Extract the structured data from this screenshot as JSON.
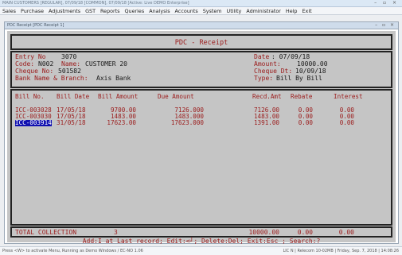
{
  "window": {
    "title": "MAIN   CUSTOMERS [REGULAR], 07/09/18   [COMMON], 07/09/18   [Active: Live DEMO   Enterprise]",
    "controls": "– ▫ ×"
  },
  "menu": [
    "Sales",
    "Purchase",
    "Adjustments",
    "GST",
    "Reports",
    "Queries",
    "Analysis",
    "Accounts",
    "System",
    "Utility",
    "Administrator",
    "Help",
    "Exit"
  ],
  "child_window": {
    "title": "PDC Receipt   [PDC Receipt 1]",
    "controls": "– ▫ ×"
  },
  "screen": {
    "title": "PDC - Receipt",
    "entry": {
      "entry_no_label": "Entry No",
      "entry_no": "3070",
      "code_label": "Code:",
      "code": "N002",
      "name_label": "Name:",
      "name": "CUSTOMER 20",
      "cheque_no_label": "Cheque No:",
      "cheque_no": "501582",
      "bank_label": "Bank Name & Branch:",
      "bank": "Axis Bank",
      "date_label": "Date",
      "date": ": 07/09/18",
      "amount_label": "Amount:",
      "amount": "10000.00",
      "cheque_dt_label": "Cheque Dt:",
      "cheque_dt": "10/09/18",
      "type_label": "Type:",
      "type": "Bill By Bill"
    },
    "columns": [
      "Bill No.",
      "Bill Date",
      "Bill Amount",
      "Due Amount",
      "Recd.Amt",
      "Rebate",
      "Interest"
    ],
    "rows": [
      {
        "bill_no": "ICC-003028",
        "bill_date": "17/05/18",
        "bill_amount": "9700.00",
        "due_amount": "7126.000",
        "recd_amt": "7126.00",
        "rebate": "0.00",
        "interest": "0.00",
        "selected": false
      },
      {
        "bill_no": "ICC-003030",
        "bill_date": "17/05/18",
        "bill_amount": "1483.00",
        "due_amount": "1483.000",
        "recd_amt": "1483.00",
        "rebate": "0.00",
        "interest": "0.00",
        "selected": false
      },
      {
        "bill_no": "ICC-003914",
        "bill_date": "31/05/18",
        "bill_amount": "17623.00",
        "due_amount": "17623.000",
        "recd_amt": "1391.00",
        "rebate": "0.00",
        "interest": "0.00",
        "selected": true
      }
    ],
    "total": {
      "label": "TOTAL COLLECTION",
      "count": "3",
      "recd": "10000.00",
      "rebate": "0.00",
      "interest": "0.00"
    },
    "footer": "Add:I at Last record; Edit:<┘; Delete:Del; Exit:Esc ; Search:?"
  },
  "statusbar": {
    "left": "Press <W> to activate Menu, Running as Demo Windows / EC-NO 1.06",
    "right": "LIC N | Relecom 10-02MB | Friday, Sep. 7, 2018 | 14:08:26"
  },
  "colors": {
    "screen_bg": "#c5c5c5",
    "text_red": "#9b1b1b",
    "selection": "#1010b0"
  }
}
